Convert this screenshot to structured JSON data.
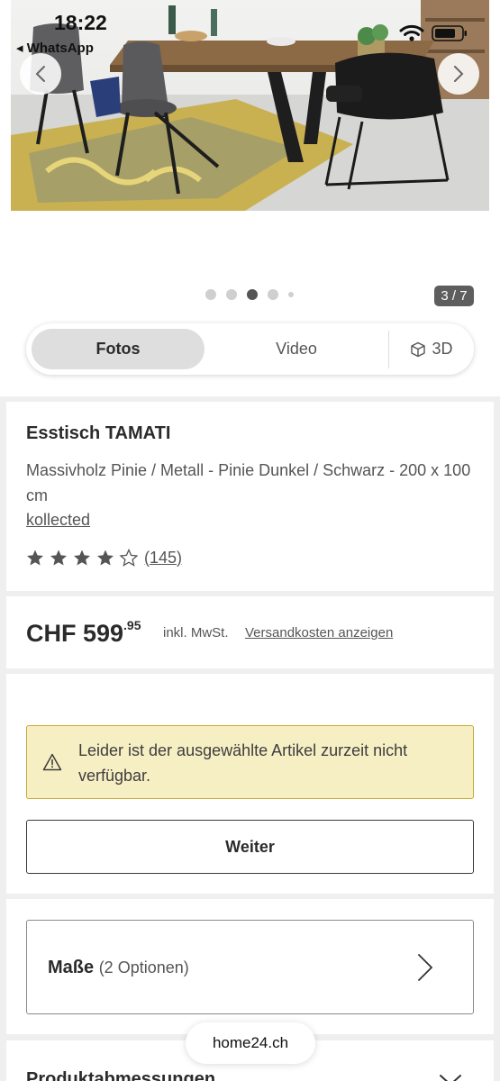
{
  "status_bar": {
    "time": "18:22",
    "back_app": "◂ WhatsApp"
  },
  "gallery": {
    "prev_icon": "chevron-left-icon",
    "next_icon": "chevron-right-icon",
    "dots_total": 5,
    "dots_active_index": 2,
    "counter": "3 / 7"
  },
  "media_tabs": {
    "fotos": "Fotos",
    "video": "Video",
    "three_d": "3D",
    "active": "Fotos"
  },
  "product": {
    "title": "Esstisch TAMATI",
    "description": "Massivholz Pinie / Metall - Pinie Dunkel / Schwarz - 200 x 100 cm",
    "brand": "kollected",
    "rating": 4.5,
    "rating_count": "(145)"
  },
  "price": {
    "currency_amount": "CHF 599",
    "cents": ".95",
    "vat": "inkl. MwSt.",
    "shipping_link": "Versandkosten anzeigen"
  },
  "availability": {
    "message": "Leider ist der ausgewählte Artikel zurzeit nicht verfügbar.",
    "continue_button": "Weiter"
  },
  "options": {
    "label": "Maße",
    "count": "(2 Optionen)"
  },
  "dimensions": {
    "title": "Produktabmessungen"
  },
  "browser": {
    "url": "home24.ch"
  },
  "colors": {
    "alert_bg": "#f7efc4",
    "alert_border": "#c9a93a",
    "text_dark": "#2b2b2b",
    "text_muted": "#555555"
  }
}
